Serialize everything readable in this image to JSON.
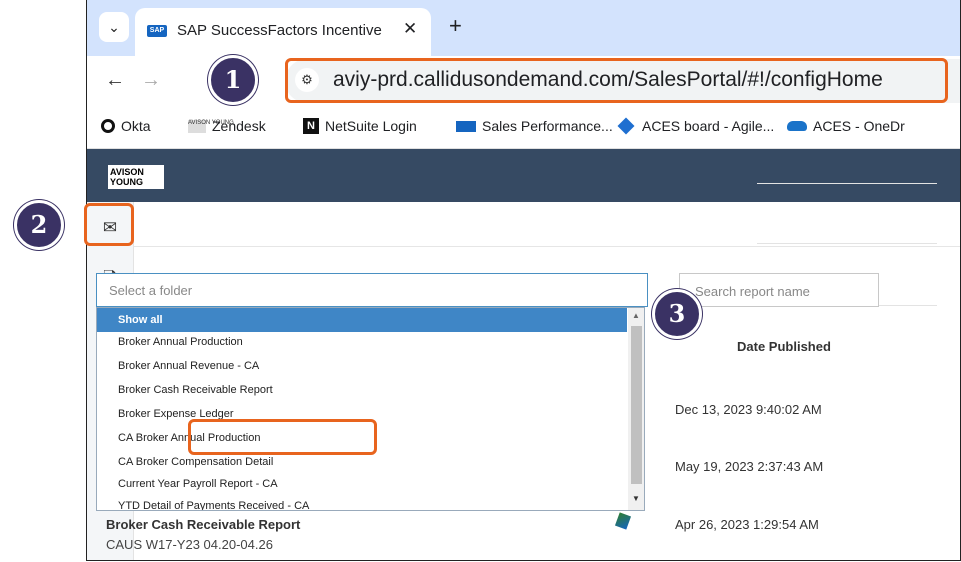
{
  "browser": {
    "tab_title": "SAP SuccessFactors Incentive M",
    "tab_favicon": "SAP",
    "url": "aviy-prd.callidusondemand.com/SalesPortal/#!/configHome",
    "bookmarks": [
      {
        "icon": "okta-icon",
        "label": "Okta"
      },
      {
        "icon": "zendesk-icon",
        "label": "Zendesk"
      },
      {
        "icon": "netsuite-icon",
        "label": "NetSuite Login"
      },
      {
        "icon": "sap-icon",
        "label": "Sales Performance..."
      },
      {
        "icon": "jira-icon",
        "label": "ACES board - Agile..."
      },
      {
        "icon": "onedrive-icon",
        "label": "ACES - OneDr"
      }
    ]
  },
  "app": {
    "logo_text": "AVISON YOUNG",
    "sidebar_icons": [
      "mail-icon",
      "reports-icon",
      "settings-gear-icon"
    ],
    "folder_select": {
      "placeholder": "Select a folder"
    },
    "search_placeholder": "Search report name",
    "column_header": "Date Published",
    "dropdown_options": [
      "Show all",
      "Broker Annual Production",
      "Broker Annual Revenue - CA",
      "Broker Cash Receivable Report",
      "Broker Expense Ledger",
      "CA Broker Annual Production",
      "CA Broker Compensation Detail",
      "Current Year Payroll Report - CA",
      "YTD Detail of Payments Received - CA"
    ],
    "selected_option": "Show all",
    "dates": [
      "Dec 13, 2023 9:40:02 AM",
      "May 19, 2023 2:37:43 AM",
      "Apr 26, 2023 1:29:54 AM"
    ],
    "visible_row": {
      "title": "Broker Cash Receivable Report",
      "subtitle": "CAUS W17-Y23 04.20-04.26"
    }
  },
  "annotations": {
    "step1": "1",
    "step2": "2",
    "step3": "3"
  },
  "colors": {
    "highlight": "#e8641e",
    "badge": "#3a3264",
    "header": "#364a63",
    "selected": "#3f86c6"
  }
}
